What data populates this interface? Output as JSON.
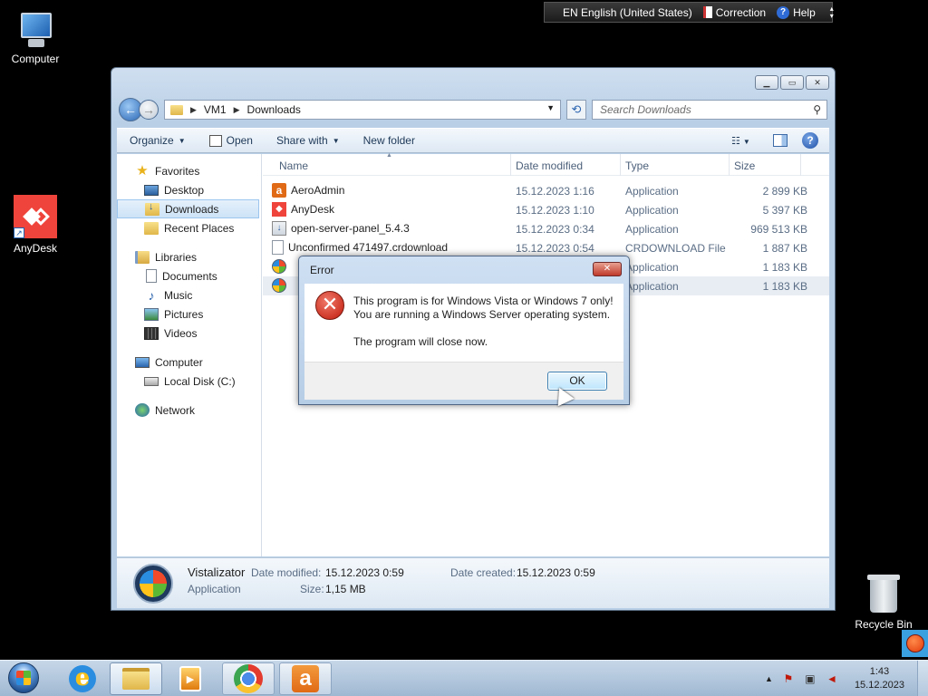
{
  "desktop": {
    "icons": {
      "computer": "Computer",
      "anydesk": "AnyDesk",
      "recycle_bin": "Recycle Bin"
    }
  },
  "language_bar": {
    "language": "EN English (United States)",
    "correction": "Correction",
    "help": "Help"
  },
  "explorer": {
    "address": {
      "root": "VM1",
      "current": "Downloads"
    },
    "search_placeholder": "Search Downloads",
    "toolbar": {
      "organize": "Organize",
      "open": "Open",
      "share_with": "Share with",
      "new_folder": "New folder"
    },
    "nav": {
      "favorites": "Favorites",
      "desktop": "Desktop",
      "downloads": "Downloads",
      "recent_places": "Recent Places",
      "libraries": "Libraries",
      "documents": "Documents",
      "music": "Music",
      "pictures": "Pictures",
      "videos": "Videos",
      "computer": "Computer",
      "local_disk": "Local Disk (C:)",
      "network": "Network"
    },
    "columns": {
      "name": "Name",
      "date_modified": "Date modified",
      "type": "Type",
      "size": "Size"
    },
    "files": [
      {
        "name": "AeroAdmin",
        "date": "15.12.2023 1:16",
        "type": "Application",
        "size": "2 899 KB"
      },
      {
        "name": "AnyDesk",
        "date": "15.12.2023 1:10",
        "type": "Application",
        "size": "5 397 KB"
      },
      {
        "name": "open-server-panel_5.4.3",
        "date": "15.12.2023 0:34",
        "type": "Application",
        "size": "969 513 KB"
      },
      {
        "name": "Unconfirmed 471497.crdownload",
        "date": "15.12.2023 0:54",
        "type": "CRDOWNLOAD File",
        "size": "1 887 KB"
      },
      {
        "type": "Application",
        "size": "1 183 KB"
      },
      {
        "type": "Application",
        "size": "1 183 KB"
      }
    ],
    "details": {
      "name": "Vistalizator",
      "type": "Application",
      "date_modified_label": "Date modified:",
      "date_modified": "15.12.2023 0:59",
      "date_created_label": "Date created:",
      "date_created": "15.12.2023 0:59",
      "size_label": "Size:",
      "size": "1,15 MB"
    }
  },
  "dialog": {
    "title": "Error",
    "line1": "This program is for Windows Vista or Windows 7 only!",
    "line2": "You are running a Windows Server operating system.",
    "line3": "The program will close now.",
    "ok": "OK"
  },
  "taskbar": {
    "time": "1:43",
    "date": "15.12.2023"
  }
}
